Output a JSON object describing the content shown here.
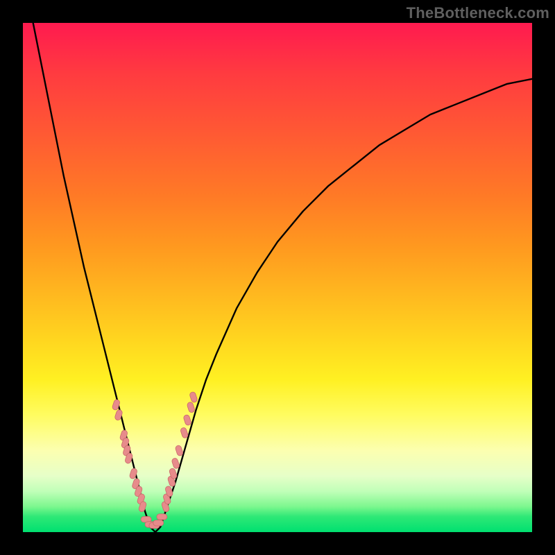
{
  "watermark": "TheBottleneck.com",
  "colors": {
    "frame": "#000000",
    "curve": "#000000",
    "marker_fill": "#e78b8b",
    "marker_stroke": "#c96a6a",
    "gradient_top": "#ff1a4f",
    "gradient_bottom": "#00e070"
  },
  "chart_data": {
    "type": "line",
    "title": "",
    "xlabel": "",
    "ylabel": "",
    "xlim": [
      0,
      100
    ],
    "ylim": [
      0,
      100
    ],
    "grid": false,
    "legend": false,
    "notes": "V-shaped bottleneck-style curve with rainbow gradient background. No axis tick labels are visible; x and y are normalized 0–100 (x left→right, y bottom→top). Pink rounded markers cluster on both inner walls of the V near the bottom.",
    "series": [
      {
        "name": "curve",
        "x": [
          2,
          4,
          6,
          8,
          10,
          12,
          14,
          16,
          18,
          19,
          20,
          21,
          22,
          23,
          24,
          25,
          26,
          27,
          28,
          30,
          32,
          34,
          36,
          38,
          42,
          46,
          50,
          55,
          60,
          65,
          70,
          75,
          80,
          85,
          90,
          95,
          100
        ],
        "y": [
          100,
          90,
          80,
          70,
          61,
          52,
          44,
          36,
          28,
          24,
          20,
          16,
          12,
          8,
          4,
          1,
          0,
          1,
          4,
          10,
          17,
          24,
          30,
          35,
          44,
          51,
          57,
          63,
          68,
          72,
          76,
          79,
          82,
          84,
          86,
          88,
          89
        ]
      }
    ],
    "markers": {
      "left_branch": [
        {
          "x": 18.3,
          "y": 25
        },
        {
          "x": 18.8,
          "y": 23
        },
        {
          "x": 19.8,
          "y": 19
        },
        {
          "x": 20.1,
          "y": 17.5
        },
        {
          "x": 20.4,
          "y": 16
        },
        {
          "x": 20.8,
          "y": 14.5
        },
        {
          "x": 21.7,
          "y": 11.5
        },
        {
          "x": 22.2,
          "y": 9.5
        },
        {
          "x": 22.7,
          "y": 8
        },
        {
          "x": 23.2,
          "y": 6.5
        },
        {
          "x": 23.5,
          "y": 5
        }
      ],
      "right_branch": [
        {
          "x": 28.0,
          "y": 5
        },
        {
          "x": 28.3,
          "y": 6.5
        },
        {
          "x": 28.7,
          "y": 8
        },
        {
          "x": 29.2,
          "y": 10
        },
        {
          "x": 29.5,
          "y": 11.5
        },
        {
          "x": 30.0,
          "y": 13.5
        },
        {
          "x": 30.7,
          "y": 16
        },
        {
          "x": 31.7,
          "y": 19.5
        },
        {
          "x": 32.3,
          "y": 22
        },
        {
          "x": 33.0,
          "y": 24.5
        },
        {
          "x": 33.5,
          "y": 26.5
        }
      ],
      "bottom": [
        {
          "x": 24.2,
          "y": 2.5
        },
        {
          "x": 25.0,
          "y": 1.5
        },
        {
          "x": 25.8,
          "y": 1.3
        },
        {
          "x": 26.6,
          "y": 1.8
        },
        {
          "x": 27.3,
          "y": 3
        }
      ]
    }
  }
}
